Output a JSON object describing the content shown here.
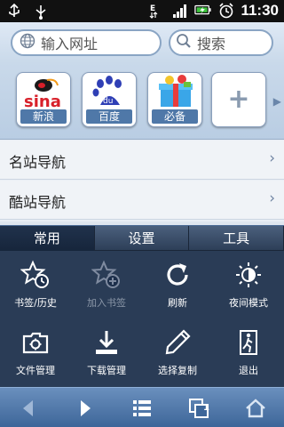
{
  "status_bar": {
    "time": "11:30",
    "icons": [
      "usb-icon",
      "signal-icon",
      "battery-icon",
      "alarm-icon",
      "data-e-icon"
    ]
  },
  "search_row": {
    "url_placeholder": "输入网址",
    "search_placeholder": "搜索"
  },
  "quick_links": [
    {
      "label": "新浪",
      "icon": "sina-logo"
    },
    {
      "label": "百度",
      "icon": "baidu-paw-logo"
    },
    {
      "label": "必备",
      "icon": "gift-box-icon"
    },
    {
      "label": "",
      "icon": "plus-icon"
    }
  ],
  "nav_rows": [
    {
      "label": "名站导航"
    },
    {
      "label": "酷站导航"
    }
  ],
  "menu": {
    "tabs": [
      {
        "label": "常用",
        "active": true
      },
      {
        "label": "设置",
        "active": false
      },
      {
        "label": "工具",
        "active": false
      }
    ],
    "items": [
      {
        "label": "书签/历史",
        "icon": "bookmark-history-icon",
        "enabled": true
      },
      {
        "label": "加入书签",
        "icon": "add-bookmark-icon",
        "enabled": false
      },
      {
        "label": "刷新",
        "icon": "refresh-icon",
        "enabled": true
      },
      {
        "label": "夜间模式",
        "icon": "night-mode-icon",
        "enabled": true
      },
      {
        "label": "文件管理",
        "icon": "folder-icon",
        "enabled": true
      },
      {
        "label": "下载管理",
        "icon": "download-icon",
        "enabled": true
      },
      {
        "label": "选择复制",
        "icon": "pencil-icon",
        "enabled": true
      },
      {
        "label": "退出",
        "icon": "exit-icon",
        "enabled": true
      }
    ]
  },
  "toolbar": {
    "buttons": [
      "back-icon",
      "forward-icon",
      "menu-list-icon",
      "windows-icon",
      "home-icon"
    ],
    "window_count": "1"
  },
  "colors": {
    "accent": "#4f78a8",
    "menu_bg": "#1c2e4a",
    "toolbar": "#3d6699"
  }
}
